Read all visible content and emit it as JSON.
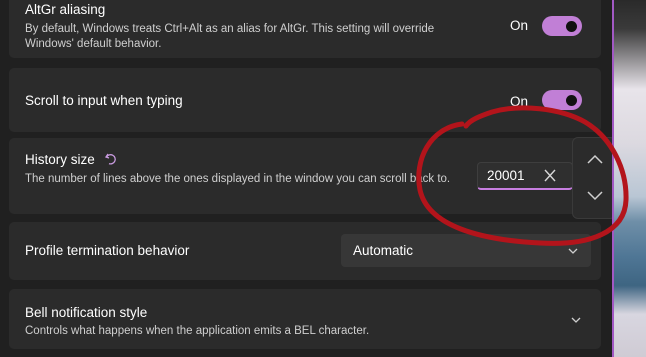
{
  "settings": {
    "altgr": {
      "title": "AltGr aliasing",
      "description": "By default, Windows treats Ctrl+Alt as an alias for AltGr. This setting will override Windows' default behavior.",
      "toggle_label": "On"
    },
    "scroll_to_input": {
      "title": "Scroll to input when typing",
      "toggle_label": "On"
    },
    "history_size": {
      "title": "History size",
      "reset_icon": "reset-arrow-icon",
      "description": "The number of lines above the ones displayed in the window you can scroll back to.",
      "value": "20001"
    },
    "profile_termination": {
      "title": "Profile termination behavior",
      "selected": "Automatic"
    },
    "bell_notification": {
      "title": "Bell notification style",
      "description": "Controls what happens when the application emits a BEL character."
    }
  },
  "colors": {
    "accent": "#c17fd6",
    "card_background": "#2b2b2b",
    "page_background": "#202020",
    "annotation": "#b3141b"
  }
}
